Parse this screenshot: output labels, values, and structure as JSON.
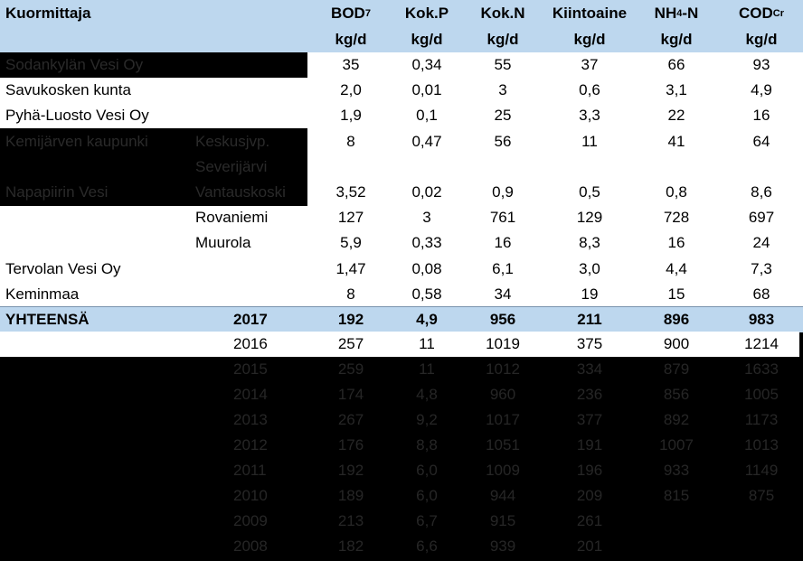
{
  "header": {
    "col0": "Kuormittaja",
    "bod": "BOD",
    "bod_sub": "7",
    "kokp": "Kok.P",
    "kokn": "Kok.N",
    "kiint": "Kiintoaine",
    "nh4_a": "NH",
    "nh4_sub": "4",
    "nh4_b": "-N",
    "cod": "COD",
    "cod_sub": "Cr",
    "unit": "kg/d"
  },
  "rows": [
    {
      "name": "Sodankylän Vesi Oy",
      "sub": "",
      "v": [
        "35",
        "0,34",
        "55",
        "37",
        "66",
        "93"
      ]
    },
    {
      "name": "Savukosken kunta",
      "sub": "",
      "v": [
        "2,0",
        "0,01",
        "3",
        "0,6",
        "3,1",
        "4,9"
      ]
    },
    {
      "name": "Pyhä-Luosto Vesi Oy",
      "sub": "",
      "v": [
        "1,9",
        "0,1",
        "25",
        "3,3",
        "22",
        "16"
      ]
    },
    {
      "name": "Kemijärven kaupunki",
      "sub": "Keskusjvp.",
      "v": [
        "8",
        "0,47",
        "56",
        "11",
        "41",
        "64"
      ]
    },
    {
      "name": "",
      "sub": "Severijärvi",
      "v": [
        "",
        "",
        "",
        "",
        "",
        ""
      ]
    },
    {
      "name": "Napapiirin Vesi",
      "sub": "Vantauskoski",
      "v": [
        "3,52",
        "0,02",
        "0,9",
        "0,5",
        "0,8",
        "8,6"
      ]
    },
    {
      "name": "",
      "sub": "Rovaniemi",
      "v": [
        "127",
        "3",
        "761",
        "129",
        "728",
        "697"
      ]
    },
    {
      "name": "",
      "sub": "Muurola",
      "v": [
        "5,9",
        "0,33",
        "16",
        "8,3",
        "16",
        "24"
      ]
    },
    {
      "name": "Tervolan Vesi Oy",
      "sub": "",
      "v": [
        "1,47",
        "0,08",
        "6,1",
        "3,0",
        "4,4",
        "7,3"
      ]
    },
    {
      "name": "Keminmaa",
      "sub": "",
      "v": [
        "8",
        "0,58",
        "34",
        "19",
        "15",
        "68"
      ]
    }
  ],
  "total": {
    "label": "YHTEENSÄ",
    "year": "2017",
    "v": [
      "192",
      "4,9",
      "956",
      "211",
      "896",
      "983"
    ]
  },
  "years": [
    {
      "year": "2016",
      "v": [
        "257",
        "11",
        "1019",
        "375",
        "900",
        "1214"
      ]
    },
    {
      "year": "2015",
      "v": [
        "259",
        "11",
        "1012",
        "334",
        "879",
        "1633"
      ]
    },
    {
      "year": "2014",
      "v": [
        "174",
        "4,8",
        "960",
        "236",
        "856",
        "1005"
      ]
    },
    {
      "year": "2013",
      "v": [
        "267",
        "9,2",
        "1017",
        "377",
        "892",
        "1173"
      ]
    },
    {
      "year": "2012",
      "v": [
        "176",
        "8,8",
        "1051",
        "191",
        "1007",
        "1013"
      ]
    },
    {
      "year": "2011",
      "v": [
        "192",
        "6,0",
        "1009",
        "196",
        "933",
        "1149"
      ]
    },
    {
      "year": "2010",
      "v": [
        "189",
        "6,0",
        "944",
        "209",
        "815",
        "875"
      ]
    },
    {
      "year": "2009",
      "v": [
        "213",
        "6,7",
        "915",
        "261",
        "",
        ""
      ]
    },
    {
      "year": "2008",
      "v": [
        "182",
        "6,6",
        "939",
        "201",
        "",
        ""
      ]
    }
  ]
}
